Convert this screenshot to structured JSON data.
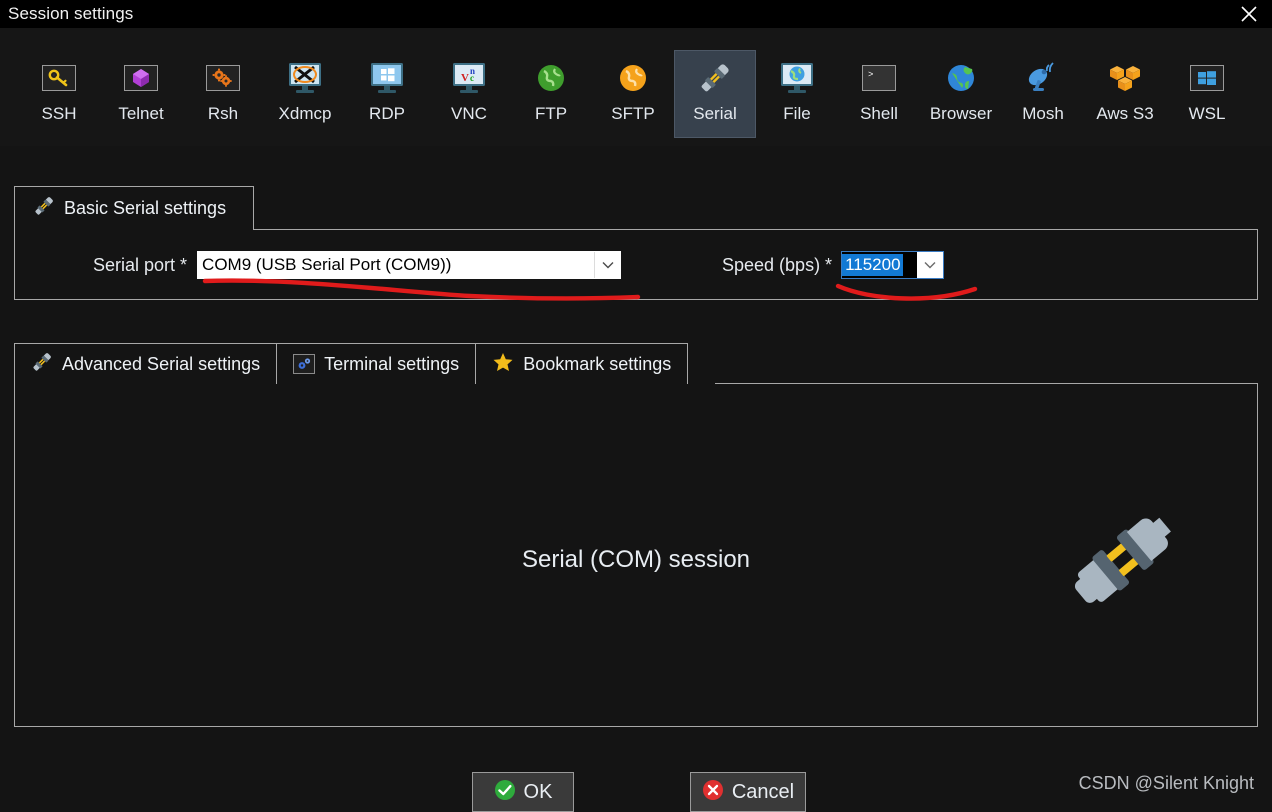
{
  "window": {
    "title": "Session settings",
    "close_icon": "close-icon"
  },
  "session_types": [
    {
      "label": "SSH",
      "icon": "ssh-key-icon",
      "selected": false
    },
    {
      "label": "Telnet",
      "icon": "telnet-cube-icon",
      "selected": false
    },
    {
      "label": "Rsh",
      "icon": "rsh-gears-icon",
      "selected": false
    },
    {
      "label": "Xdmcp",
      "icon": "xdmcp-monitor-icon",
      "selected": false
    },
    {
      "label": "RDP",
      "icon": "rdp-windows-icon",
      "selected": false
    },
    {
      "label": "VNC",
      "icon": "vnc-monitor-icon",
      "selected": false
    },
    {
      "label": "FTP",
      "icon": "ftp-globe-icon",
      "selected": false
    },
    {
      "label": "SFTP",
      "icon": "sftp-globe-icon",
      "selected": false
    },
    {
      "label": "Serial",
      "icon": "serial-plug-icon",
      "selected": true
    },
    {
      "label": "File",
      "icon": "file-monitor-icon",
      "selected": false
    },
    {
      "label": "Shell",
      "icon": "shell-prompt-icon",
      "selected": false
    },
    {
      "label": "Browser",
      "icon": "browser-globe-icon",
      "selected": false
    },
    {
      "label": "Mosh",
      "icon": "mosh-dish-icon",
      "selected": false
    },
    {
      "label": "Aws S3",
      "icon": "aws-s3-boxes-icon",
      "selected": false
    },
    {
      "label": "WSL",
      "icon": "wsl-windows-icon",
      "selected": false
    }
  ],
  "basic_group": {
    "tab_label": "Basic Serial settings",
    "tab_icon": "plug-icon",
    "serial_port": {
      "label": "Serial port *",
      "value": "COM9  (USB Serial Port (COM9))",
      "dropdown_icon": "chevron-down-icon"
    },
    "speed": {
      "label": "Speed (bps) *",
      "value": "115200",
      "dropdown_icon": "chevron-down-icon"
    }
  },
  "lower_tabs": [
    {
      "label": "Advanced Serial settings",
      "icon": "plug-icon",
      "active": true
    },
    {
      "label": "Terminal settings",
      "icon": "terminal-gear-icon",
      "active": false
    },
    {
      "label": "Bookmark settings",
      "icon": "star-icon",
      "active": false
    }
  ],
  "content": {
    "session_kind": "Serial (COM) session",
    "illustration_icon": "serial-plug-large-icon"
  },
  "buttons": {
    "ok": {
      "label": "OK",
      "icon": "check-circle-icon"
    },
    "cancel": {
      "label": "Cancel",
      "icon": "x-circle-icon"
    }
  },
  "watermark": "CSDN @Silent Knight",
  "colors": {
    "window_bg": "#141414",
    "titlebar_bg": "#000000",
    "toolbar_bg": "#161616",
    "selected_item_bg": "#37414d",
    "border": "#a8a8a8",
    "text": "#e8edf2",
    "annotation_red": "#e01b1b",
    "selection_blue": "#1279d4",
    "ok_green": "#2eab3c",
    "cancel_red": "#e03030"
  },
  "annotations": [
    {
      "name": "serial-port-underline",
      "color": "#e01b1b"
    },
    {
      "name": "speed-underline",
      "color": "#e01b1b"
    }
  ]
}
